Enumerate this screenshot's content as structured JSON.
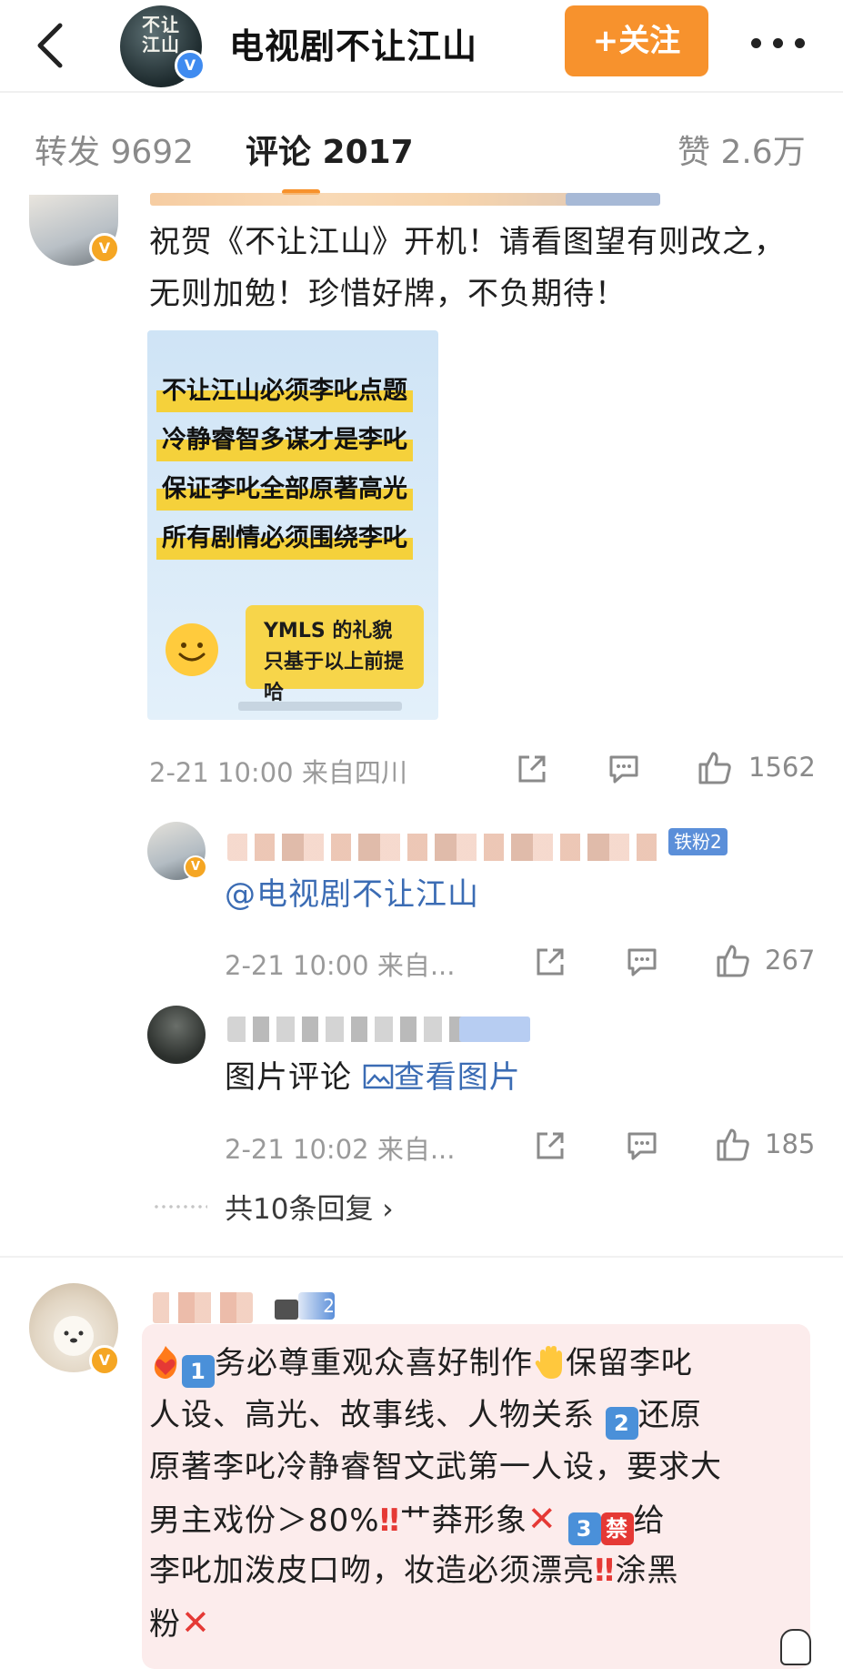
{
  "header": {
    "channel_name": "电视剧不让江山",
    "avatar_text": "不让江山",
    "follow_label": "+关注",
    "verified": "V"
  },
  "tabs": [
    {
      "label": "转发 9692"
    },
    {
      "label": "评论 2017"
    },
    {
      "label": "赞 2.6万"
    }
  ],
  "comment1": {
    "text_line1": "祝贺《不让江山》开机！请看图望有则改之，",
    "text_line2": "无则加勉！珍惜好牌，不负期待！",
    "image": {
      "rows": [
        "不让江山必须李叱点题",
        "冷静睿智多谋才是李叱",
        "保证李叱全部原著高光",
        "所有剧情必须围绕李叱"
      ],
      "speech_line1": "YMLS 的礼貌",
      "speech_line2": "只基于以上前提哈"
    },
    "meta": "2-21 10:00 来自四川",
    "likes": "1562"
  },
  "reply1": {
    "fan_badge": "铁粉2",
    "text": "@电视剧不让江山",
    "meta": "2-21 10:00 来自...",
    "likes": "267"
  },
  "reply2": {
    "text_prefix": "图片评论 ",
    "link_text": "查看图片",
    "meta": "2-21 10:02 来自...",
    "likes": "185"
  },
  "reply_summary": "共10条回复 ›",
  "comment2": {
    "fan_level": "2",
    "lines": [
      "务必尊重观众喜好制作",
      "保留李叱",
      "人设、高光、故事线、人物关系 ",
      "还原",
      "原著李叱冷静睿智文武第一人设，要求大",
      "男主戏份＞80%",
      "艹莽形象",
      "给",
      "李叱加泼皮口吻，妆造必须漂亮",
      "涂黑",
      "粉"
    ],
    "emoji_1": "1",
    "emoji_2": "2",
    "emoji_3": "3",
    "emoji_ban": "禁",
    "bang": "‼",
    "cross": "✕"
  },
  "colors": {
    "accent": "#f7922d",
    "meta": "#9a9a9a",
    "link": "#3b6cb4"
  }
}
